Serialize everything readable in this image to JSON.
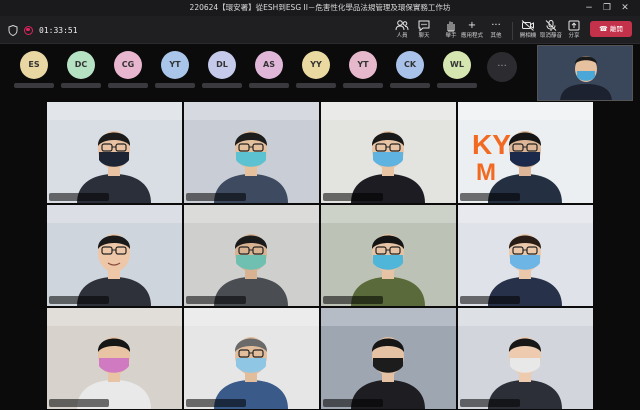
{
  "window": {
    "title": "220624【環安署】從ESH到ESG II－危害性化學品法規管理及環保實務工作坊",
    "controls": [
      "minimize-icon",
      "restore-icon",
      "close-icon"
    ]
  },
  "meeting": {
    "timer": "01:33:51",
    "actions": [
      {
        "name": "people",
        "label": "人員",
        "icon": "people-icon"
      },
      {
        "name": "chat",
        "label": "聊天",
        "icon": "chat-icon"
      },
      {
        "name": "raise-hand",
        "label": "舉手",
        "icon": "hand-icon"
      },
      {
        "name": "apps",
        "label": "應用程式",
        "icon": "plus-icon"
      },
      {
        "name": "more",
        "label": "其他",
        "icon": "more-icon"
      },
      {
        "name": "camera",
        "label": "開相機",
        "icon": "camera-off-icon"
      },
      {
        "name": "mic",
        "label": "取消靜音",
        "icon": "mic-off-icon"
      },
      {
        "name": "share",
        "label": "分享",
        "icon": "share-icon"
      }
    ],
    "leave_label": "離開",
    "leave_icon": "phone-hangup-icon"
  },
  "strip": {
    "avatars": [
      {
        "initials": "ES",
        "color": "#e8d6a3"
      },
      {
        "initials": "DC",
        "color": "#b6e2c4"
      },
      {
        "initials": "CG",
        "color": "#e8b6cf"
      },
      {
        "initials": "YT",
        "color": "#a9c6ea"
      },
      {
        "initials": "DL",
        "color": "#c5c9ea"
      },
      {
        "initials": "AS",
        "color": "#e0b6d9"
      },
      {
        "initials": "YY",
        "color": "#ead9a0"
      },
      {
        "initials": "YT",
        "color": "#e6b8cb"
      },
      {
        "initials": "CK",
        "color": "#a9c2ea"
      },
      {
        "initials": "WL",
        "color": "#d6e6b0"
      }
    ],
    "more_icon": "more-icon"
  },
  "tiles": [
    {
      "bg": "#d9dee5",
      "shirt": "#2a2f3a",
      "skin": "#e8c2a2",
      "hair": "#1b1b1b",
      "mask": "#1d2535",
      "glasses": true
    },
    {
      "bg": "#c9ced6",
      "shirt": "#3d4a5f",
      "skin": "#e5c09d",
      "hair": "#1d1d1d",
      "mask": "#5cc2d2",
      "glasses": true
    },
    {
      "bg": "#e3e3e0",
      "shirt": "#1c1c22",
      "skin": "#e8c4a4",
      "hair": "#181818",
      "mask": "#5fb3e0",
      "glasses": true
    },
    {
      "bg": "#eceff2",
      "shirt": "#243042",
      "skin": "#dcb696",
      "hair": "#151515",
      "mask": "#1b2a4a",
      "glasses": true,
      "logo": true
    },
    {
      "bg": "#cfd5dc",
      "shirt": "#2e3139",
      "skin": "#edc7a7",
      "hair": "#1a1a1a",
      "mask": "",
      "glasses": true
    },
    {
      "bg": "#cfd0ce",
      "shirt": "#4a4d52",
      "skin": "#d9b292",
      "hair": "#1a1a1a",
      "mask": "#6fc0b0",
      "glasses": true
    },
    {
      "bg": "#bcc3b6",
      "shirt": "#5a6a3a",
      "skin": "#e5c3a4",
      "hair": "#141414",
      "mask": "#4fb5d9",
      "glasses": true
    },
    {
      "bg": "#dfe2e8",
      "shirt": "#27324a",
      "skin": "#ecc8ab",
      "hair": "#2a1d16",
      "mask": "#6cb5e5",
      "glasses": true
    },
    {
      "bg": "#d7d3cc",
      "shirt": "#e9e9e9",
      "skin": "#e8c4a4",
      "hair": "#161616",
      "mask": "#d07ac2",
      "glasses": false
    },
    {
      "bg": "#e6e6e6",
      "shirt": "#3a5a8a",
      "skin": "#e2bd9c",
      "hair": "#6a6a6a",
      "mask": "#8ec6e4",
      "glasses": true
    },
    {
      "bg": "#9ea6b2",
      "shirt": "#1e1e22",
      "skin": "#e5c2a4",
      "hair": "#151515",
      "mask": "#1c1c1c",
      "glasses": false
    },
    {
      "bg": "#d2d6dc",
      "shirt": "#2c2f38",
      "skin": "#eecbaf",
      "hair": "#171717",
      "mask": "#e8e8e8",
      "glasses": false
    }
  ]
}
